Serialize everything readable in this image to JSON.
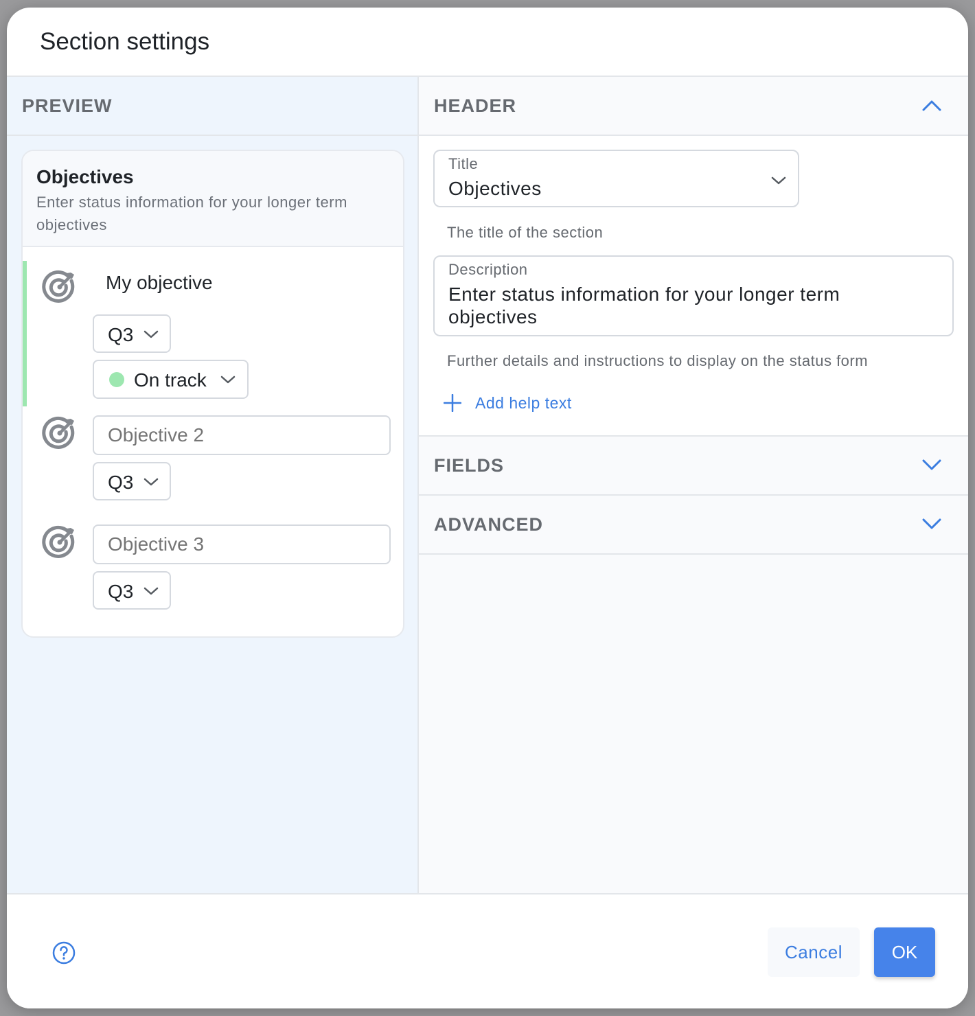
{
  "dialog": {
    "title": "Section settings"
  },
  "preview": {
    "heading": "PREVIEW",
    "card": {
      "title": "Objectives",
      "description": "Enter status information for your longer term objectives"
    },
    "objectives": [
      {
        "label": "My objective",
        "quarter": "Q3",
        "status": "On track",
        "status_color": "#9de7b0",
        "icon": "target-icon"
      },
      {
        "placeholder": "Objective 2",
        "quarter": "Q3",
        "icon": "target-icon"
      },
      {
        "placeholder": "Objective 3",
        "quarter": "Q3",
        "icon": "target-icon"
      }
    ]
  },
  "settings": {
    "header": {
      "label": "HEADER",
      "expanded": true,
      "title_field": {
        "label": "Title",
        "value": "Objectives",
        "helper": "The title of the section"
      },
      "description_field": {
        "label": "Description",
        "value": "Enter status information for your longer term objectives",
        "helper": "Further details and instructions to display on the status form"
      },
      "add_help_text": "Add help text"
    },
    "fields": {
      "label": "FIELDS",
      "expanded": false
    },
    "advanced": {
      "label": "ADVANCED",
      "expanded": false
    }
  },
  "footer": {
    "cancel_label": "Cancel",
    "ok_label": "OK",
    "help_icon": "question-circle-icon"
  },
  "colors": {
    "accent": "#4683ea",
    "link": "#3b7de0",
    "status_on_track": "#9de7b0",
    "preview_bg": "#eef5fd"
  }
}
